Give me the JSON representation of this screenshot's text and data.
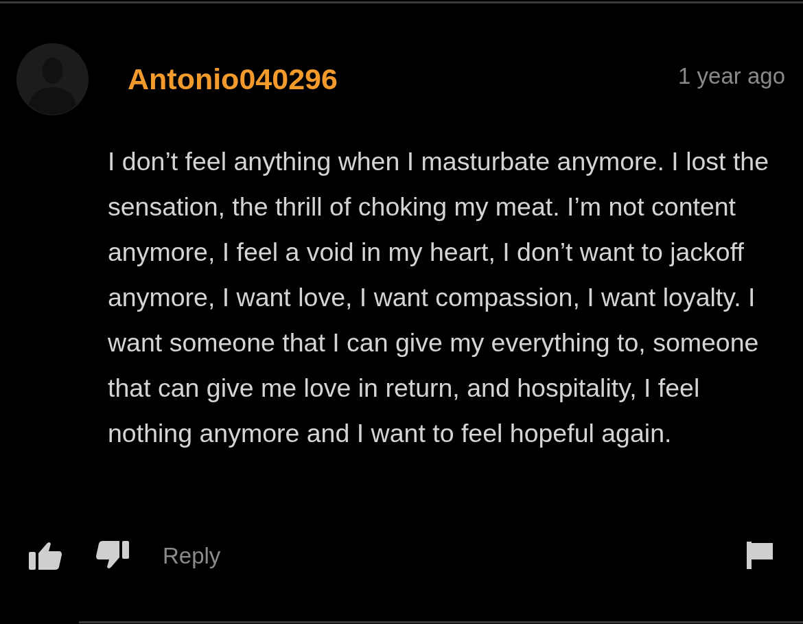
{
  "comment": {
    "username": "Antonio040296",
    "time": "1 year ago",
    "body": "I don’t feel anything when I masturbate anymore. I lost the sensation, the thrill of choking my meat. I’m not content anymore, I feel a void in my heart, I don’t want to jackoff anymore, I want love, I want compassion, I want loyalty. I want someone that I can give my everything to, someone that can give me love in return, and hospitality, I feel nothing anymore and I want to feel hopeful again.",
    "actions": {
      "reply": "Reply"
    }
  }
}
